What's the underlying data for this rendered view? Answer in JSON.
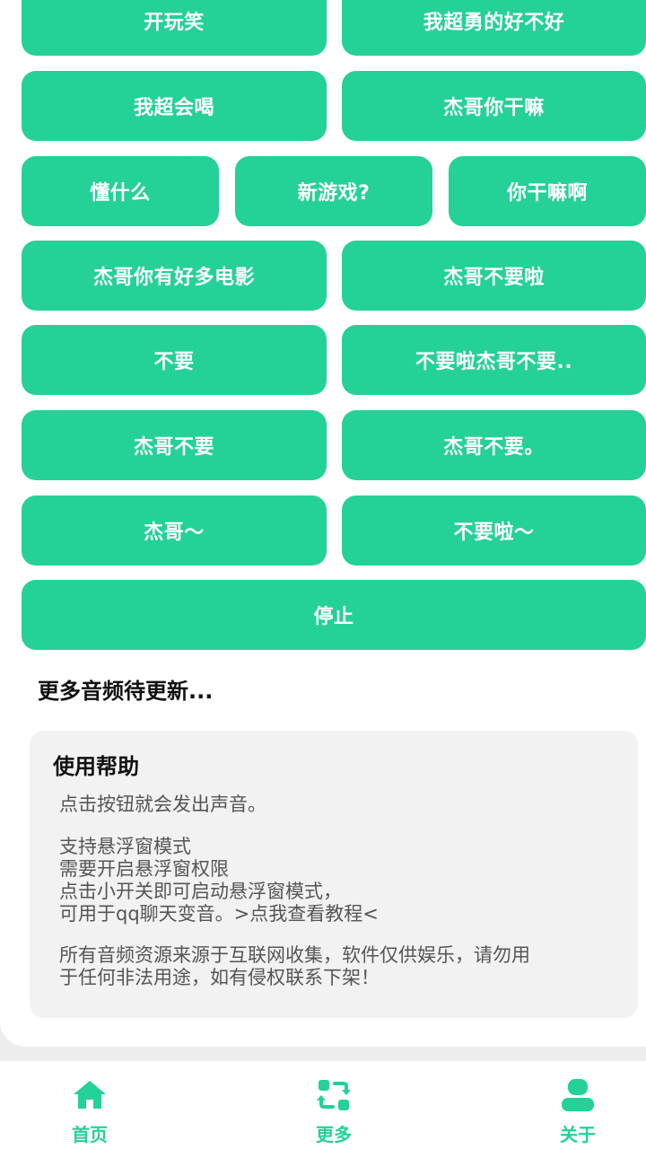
{
  "buttons": {
    "kaiwanxiao": "开玩笑",
    "wochaoyong": "我超勇的好不好",
    "wochaohuihe": "我超会喝",
    "jiegenigansha": "杰哥你干嘛",
    "dongshenme": "懂什么",
    "xinyouxi": "新游戏?",
    "niganshaa": "你干嘛啊",
    "jiegeniyouhaoduodianying": "杰哥你有好多电影",
    "jiegebuyaola": "杰哥不要啦",
    "buyao": "不要",
    "buyaolajiegebuyao": "不要啦杰哥不要..",
    "jiegebuyao": "杰哥不要",
    "jiegebuyao2": "杰哥不要。",
    "jiege": "杰哥～",
    "buyaola": "不要啦～",
    "stop": "停止"
  },
  "more_audio_label": "更多音频待更新...",
  "help": {
    "title": "使用帮助",
    "para1": "点击按钮就会发出声音。",
    "para2": "支持悬浮窗模式\n需要开启悬浮窗权限\n点击小开关即可启动悬浮窗模式，\n可用于qq聊天变音。>点我查看教程<",
    "para3": "所有音频资源来源于互联网收集，软件仅供娱乐，请勿用\n于任何非法用途，如有侵权联系下架！"
  },
  "nav": {
    "home": "首页",
    "more": "更多",
    "about": "关于"
  },
  "colors": {
    "accent": "#24d196",
    "background": "#ededed",
    "card": "#ffffff"
  },
  "icons": {
    "home": "home-icon",
    "more": "swap-icon",
    "about": "person-icon"
  }
}
